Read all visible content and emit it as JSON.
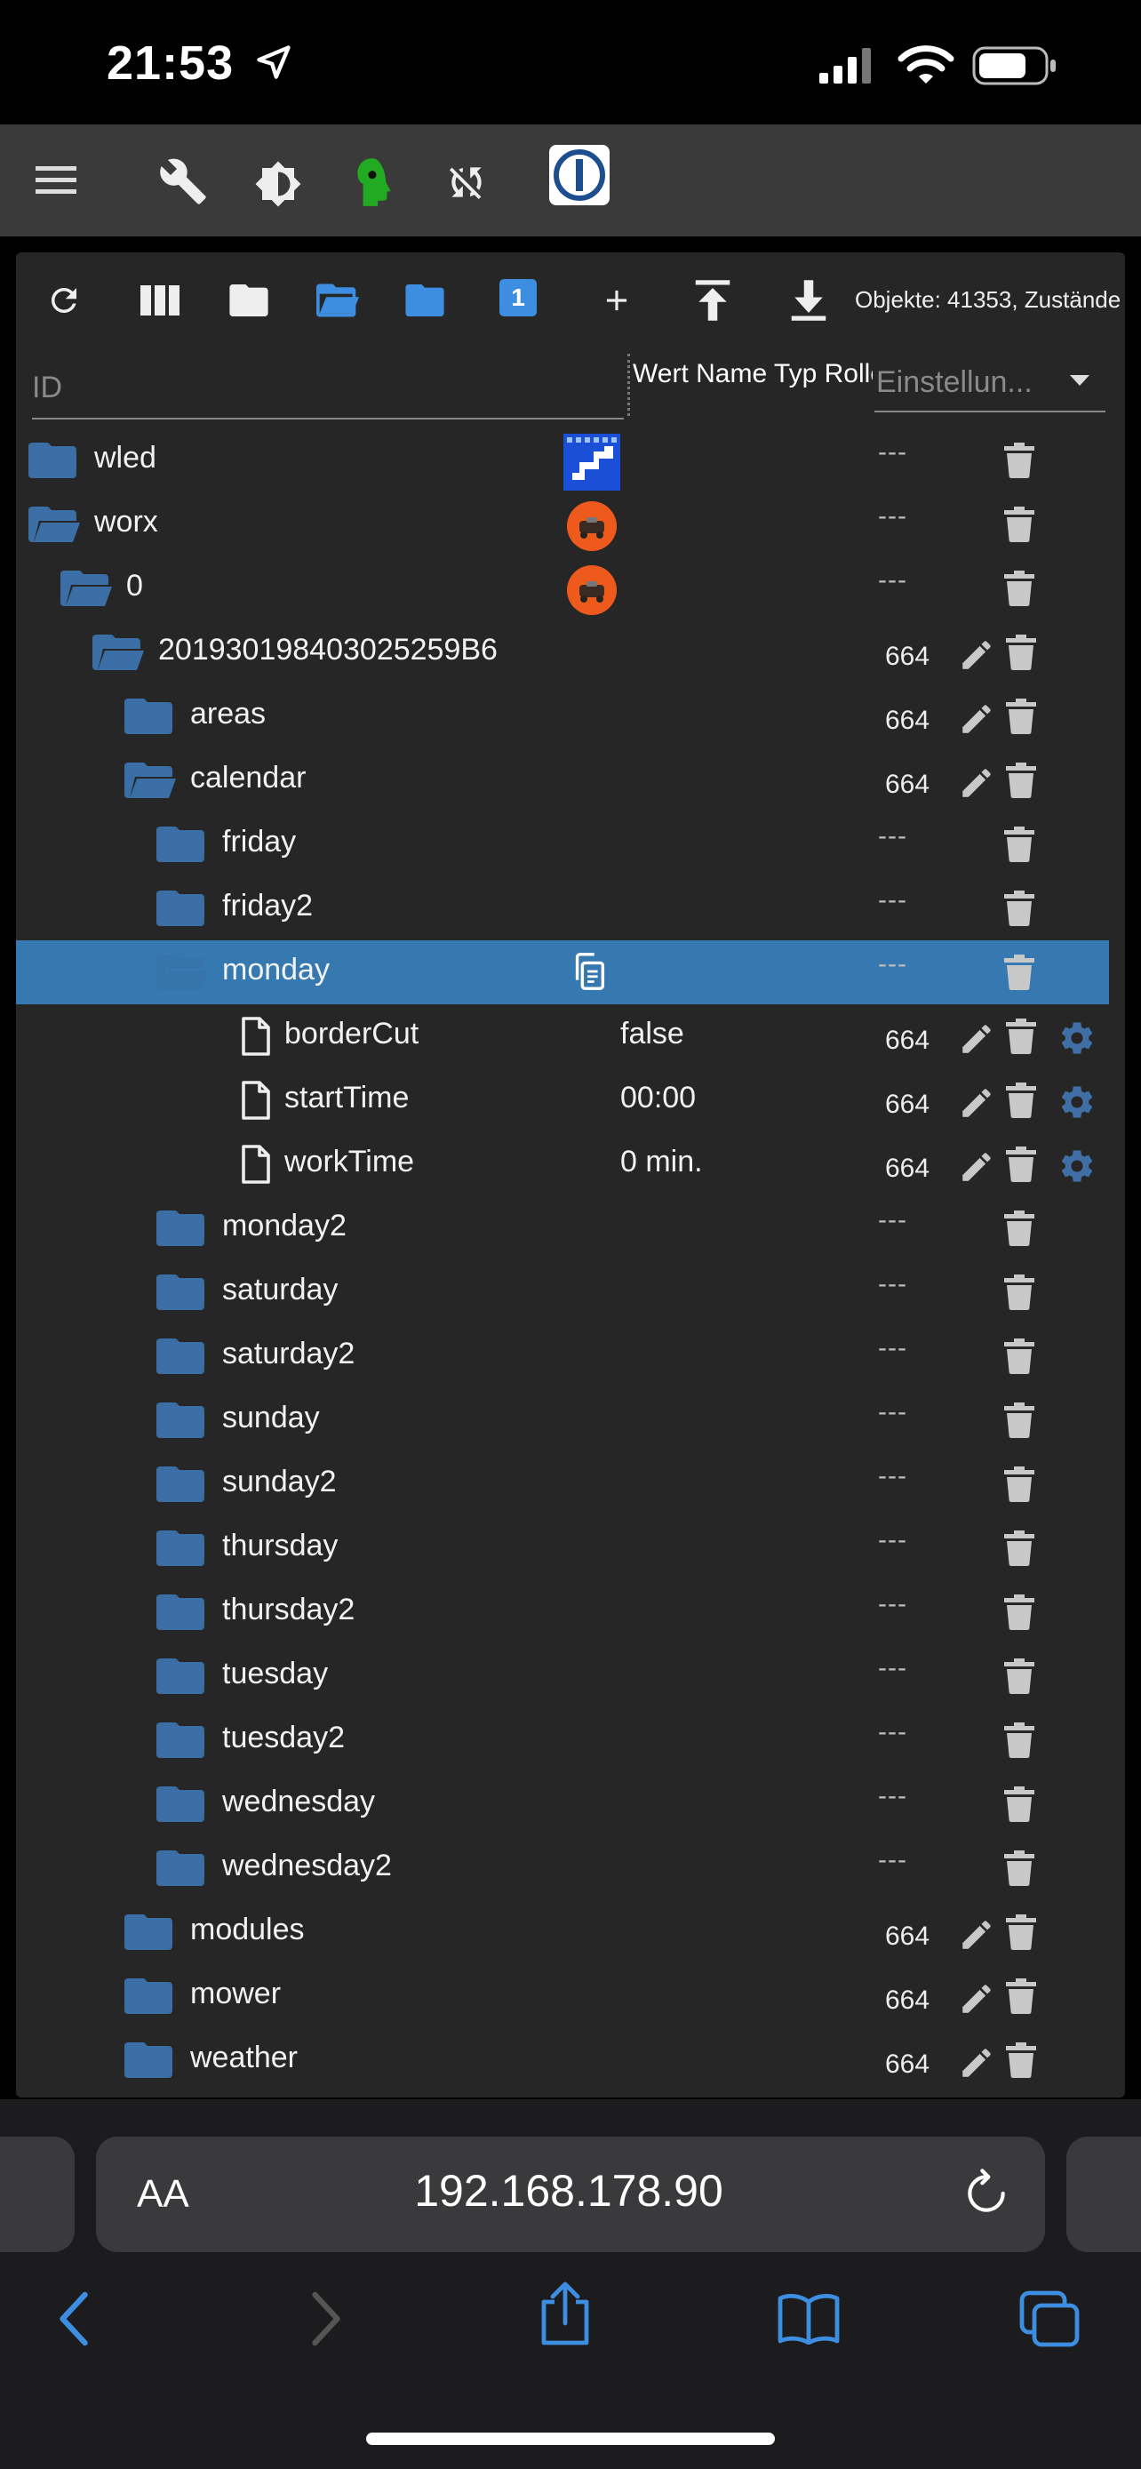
{
  "status_bar": {
    "time": "21:53"
  },
  "toolbar": {
    "object_info": "Objekte: 41353, Zustände",
    "badge_number": "1"
  },
  "columns": {
    "id_placeholder": "ID",
    "overlapping_headers": "Wert Name Typ Rolle Raum Funktion Änderung",
    "settings_placeholder": "Einstellun..."
  },
  "rows": [
    {
      "name": "wled",
      "value": "",
      "perm": "",
      "dash": "---",
      "type": "folder"
    },
    {
      "name": "worx",
      "value": "",
      "perm": "",
      "dash": "---",
      "type": "folder-open"
    },
    {
      "name": "0",
      "value": "",
      "perm": "",
      "dash": "---",
      "type": "folder-open"
    },
    {
      "name": "201930198403025259B6",
      "value": "",
      "perm": "664",
      "dash": "",
      "type": "folder-open"
    },
    {
      "name": "areas",
      "value": "",
      "perm": "664",
      "dash": "",
      "type": "folder"
    },
    {
      "name": "calendar",
      "value": "",
      "perm": "664",
      "dash": "",
      "type": "folder-open"
    },
    {
      "name": "friday",
      "value": "",
      "perm": "",
      "dash": "---",
      "type": "folder"
    },
    {
      "name": "friday2",
      "value": "",
      "perm": "",
      "dash": "---",
      "type": "folder"
    },
    {
      "name": "monday",
      "value": "",
      "perm": "",
      "dash": "---",
      "type": "folder-open"
    },
    {
      "name": "borderCut",
      "value": "false",
      "perm": "664",
      "dash": "",
      "type": "state"
    },
    {
      "name": "startTime",
      "value": "00:00",
      "perm": "664",
      "dash": "",
      "type": "state"
    },
    {
      "name": "workTime",
      "value": "0 min.",
      "perm": "664",
      "dash": "",
      "type": "state"
    },
    {
      "name": "monday2",
      "value": "",
      "perm": "",
      "dash": "---",
      "type": "folder"
    },
    {
      "name": "saturday",
      "value": "",
      "perm": "",
      "dash": "---",
      "type": "folder"
    },
    {
      "name": "saturday2",
      "value": "",
      "perm": "",
      "dash": "---",
      "type": "folder"
    },
    {
      "name": "sunday",
      "value": "",
      "perm": "",
      "dash": "---",
      "type": "folder"
    },
    {
      "name": "sunday2",
      "value": "",
      "perm": "",
      "dash": "---",
      "type": "folder"
    },
    {
      "name": "thursday",
      "value": "",
      "perm": "",
      "dash": "---",
      "type": "folder"
    },
    {
      "name": "thursday2",
      "value": "",
      "perm": "",
      "dash": "---",
      "type": "folder"
    },
    {
      "name": "tuesday",
      "value": "",
      "perm": "",
      "dash": "---",
      "type": "folder"
    },
    {
      "name": "tuesday2",
      "value": "",
      "perm": "",
      "dash": "---",
      "type": "folder"
    },
    {
      "name": "wednesday",
      "value": "",
      "perm": "",
      "dash": "---",
      "type": "folder"
    },
    {
      "name": "wednesday2",
      "value": "",
      "perm": "",
      "dash": "---",
      "type": "folder"
    },
    {
      "name": "modules",
      "value": "",
      "perm": "664",
      "dash": "",
      "type": "folder"
    },
    {
      "name": "mower",
      "value": "",
      "perm": "664",
      "dash": "",
      "type": "folder"
    },
    {
      "name": "weather",
      "value": "",
      "perm": "664",
      "dash": "",
      "type": "folder"
    }
  ],
  "browser": {
    "aa_label": "AA",
    "url": "192.168.178.90"
  },
  "colors": {
    "folder": "#3a6ea5",
    "selected_row": "#3579b0",
    "accent_blue": "#3d8ee0",
    "gear": "#3f6fa4",
    "expert_green": "#22aa22"
  }
}
